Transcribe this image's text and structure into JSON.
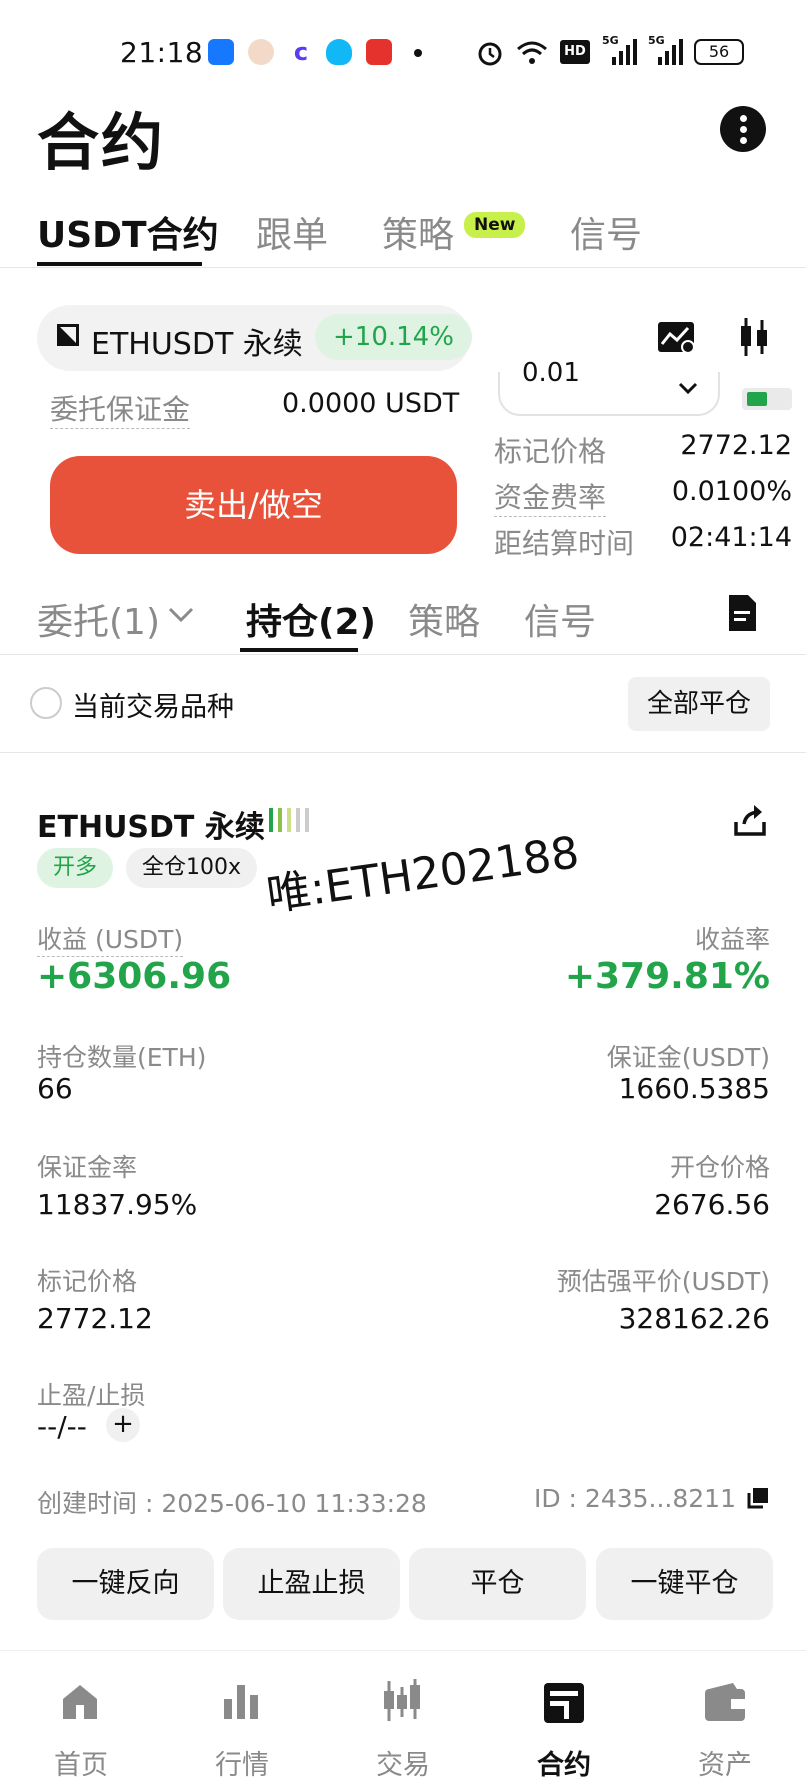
{
  "status_bar": {
    "time": "21:18",
    "battery": "56",
    "network_labels": [
      "HD",
      "5G",
      "5G"
    ]
  },
  "header": {
    "title": "合约"
  },
  "top_tabs": [
    {
      "label": "USDT合约",
      "active": true
    },
    {
      "label": "跟单",
      "active": false
    },
    {
      "label": "策略",
      "active": false,
      "badge": "New"
    },
    {
      "label": "信号",
      "active": false
    }
  ],
  "pair": {
    "name": "ETHUSDT 永续",
    "change": "+10.14%"
  },
  "order_panel": {
    "margin_label": "委托保证金",
    "margin_value": "0.0000 USDT",
    "sell_button": "卖出/做空",
    "quantity_select": "0.01"
  },
  "market_info": [
    {
      "label": "标记价格",
      "value": "2772.12"
    },
    {
      "label": "资金费率",
      "value": "0.0100%"
    },
    {
      "label": "距结算时间",
      "value": "02:41:14"
    }
  ],
  "mid_tabs": [
    {
      "label": "委托(1)",
      "active": false
    },
    {
      "label": "持仓(2)",
      "active": true
    },
    {
      "label": "策略",
      "active": false
    },
    {
      "label": "信号",
      "active": false
    }
  ],
  "filter": {
    "checkbox_label": "当前交易品种",
    "close_all": "全部平仓"
  },
  "position": {
    "symbol": "ETHUSDT 永续",
    "side_tag": "开多",
    "mode_tag": "全仓100x",
    "pnl_label": "收益 (USDT)",
    "pnl_value": "+6306.96",
    "roe_label": "收益率",
    "roe_value": "+379.81%",
    "size_label": "持仓数量(ETH)",
    "size_value": "66",
    "margin_label": "保证金(USDT)",
    "margin_value": "1660.5385",
    "margin_ratio_label": "保证金率",
    "margin_ratio_value": "11837.95%",
    "entry_label": "开仓价格",
    "entry_value": "2676.56",
    "mark_label": "标记价格",
    "mark_value": "2772.12",
    "liq_label": "预估强平价(USDT)",
    "liq_value": "328162.26",
    "tpsl_label": "止盈/止损",
    "tpsl_value": "--/--",
    "created": "创建时间 : 2025-06-10 11:33:28",
    "id": "ID : 2435...8211"
  },
  "actions": [
    "一键反向",
    "止盈止损",
    "平仓",
    "一键平仓"
  ],
  "watermark": "唯:ETH202188",
  "bottom_nav": [
    {
      "label": "首页",
      "active": false
    },
    {
      "label": "行情",
      "active": false
    },
    {
      "label": "交易",
      "active": false
    },
    {
      "label": "合约",
      "active": true
    },
    {
      "label": "资产",
      "active": false
    }
  ],
  "colors": {
    "green": "#22a54a",
    "sell": "#e8523a",
    "badge": "#c8f04a"
  }
}
